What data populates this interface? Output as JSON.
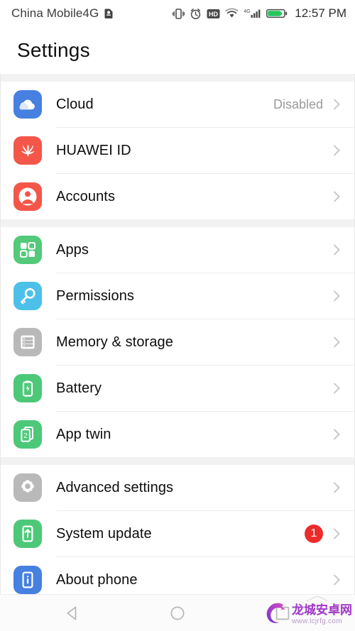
{
  "statusbar": {
    "carrier": "China Mobile4G",
    "carrier_icon": "sim-card-icon",
    "icons": [
      "vibrate-icon",
      "alarm-clock-icon",
      "hd-voice-icon",
      "wifi-icon",
      "signal-4g-icon",
      "battery-charging-icon"
    ],
    "network_label": "4G",
    "hd_label": "HD",
    "time": "12:57 PM"
  },
  "header": {
    "title": "Settings"
  },
  "groups": [
    {
      "id": "account-group",
      "items": [
        {
          "id": "cloud",
          "label": "Cloud",
          "value": "Disabled",
          "icon": "cloud-icon",
          "icon_class": "ic-cloud",
          "badge": null
        },
        {
          "id": "huawei-id",
          "label": "HUAWEI ID",
          "value": "",
          "icon": "huawei-logo-icon",
          "icon_class": "ic-huawei",
          "badge": null
        },
        {
          "id": "accounts",
          "label": "Accounts",
          "value": "",
          "icon": "person-circle-icon",
          "icon_class": "ic-accounts",
          "badge": null
        }
      ]
    },
    {
      "id": "apps-group",
      "items": [
        {
          "id": "apps",
          "label": "Apps",
          "value": "",
          "icon": "grid-apps-icon",
          "icon_class": "ic-apps",
          "badge": null
        },
        {
          "id": "permissions",
          "label": "Permissions",
          "value": "",
          "icon": "key-icon",
          "icon_class": "ic-perm",
          "badge": null
        },
        {
          "id": "memory-storage",
          "label": "Memory & storage",
          "value": "",
          "icon": "storage-stack-icon",
          "icon_class": "ic-mem",
          "badge": null
        },
        {
          "id": "battery",
          "label": "Battery",
          "value": "",
          "icon": "battery-icon",
          "icon_class": "ic-batt",
          "badge": null
        },
        {
          "id": "app-twin",
          "label": "App twin",
          "value": "",
          "icon": "app-twin-icon",
          "icon_class": "ic-twin",
          "badge": null
        }
      ]
    },
    {
      "id": "system-group",
      "items": [
        {
          "id": "advanced-settings",
          "label": "Advanced settings",
          "value": "",
          "icon": "gear-icon",
          "icon_class": "ic-adv",
          "badge": null
        },
        {
          "id": "system-update",
          "label": "System update",
          "value": "",
          "icon": "system-update-icon",
          "icon_class": "ic-sysupd",
          "badge": "1"
        },
        {
          "id": "about-phone",
          "label": "About phone",
          "value": "",
          "icon": "info-phone-icon",
          "icon_class": "ic-about",
          "badge": null
        }
      ]
    }
  ],
  "navbar": {
    "back_label": "back-triangle-icon",
    "home_label": "home-circle-icon",
    "recents_label": "recents-square-icon"
  },
  "watermark": {
    "name": "龙城安卓网",
    "url": "www.lcjrfg.com"
  },
  "colors": {
    "accent_blue": "#4680e0",
    "accent_red": "#f4564a",
    "accent_green": "#4dc878",
    "badge_red": "#ec2b2b",
    "text_primary": "#0d0d0d",
    "text_secondary": "#9a9a9a"
  }
}
